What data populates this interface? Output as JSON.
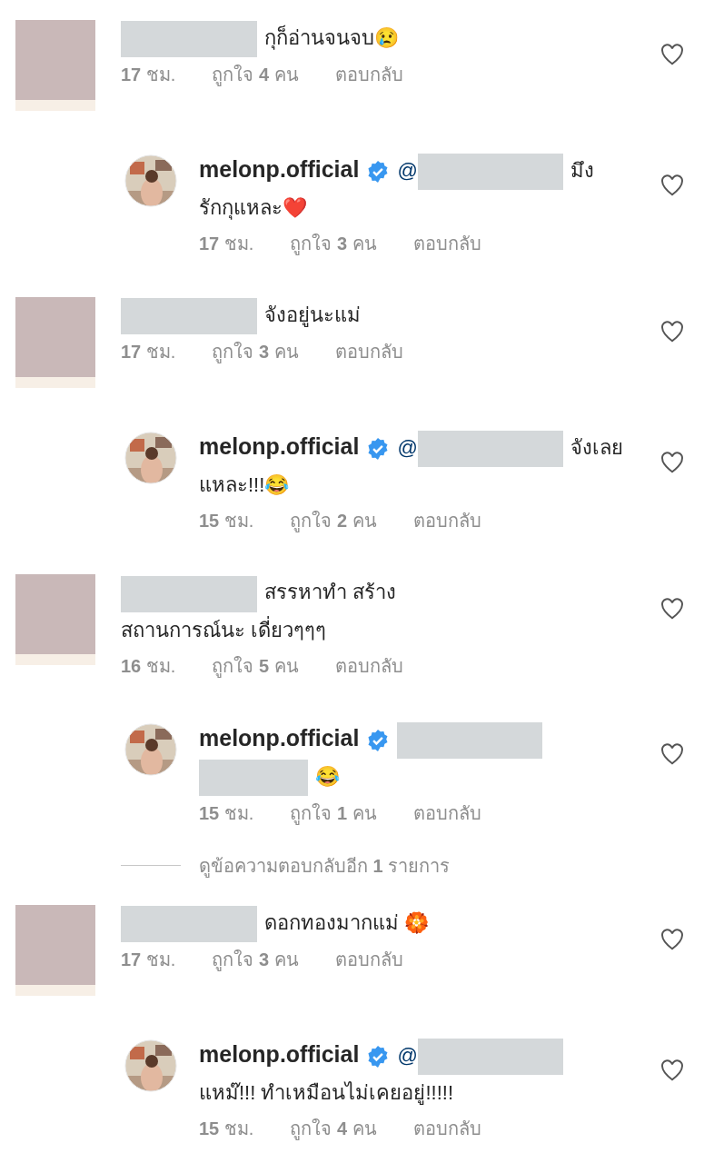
{
  "comments": [
    {
      "kind": "comment",
      "name_redacted": true,
      "head_text": "กุก็อ่านจนจบ😢",
      "time": "**17** ชม.",
      "likes": "ถูกใจ **4** คน",
      "reply_label": "ตอบกลับ",
      "liked": false
    },
    {
      "kind": "reply",
      "username": "melonp.official",
      "verified": true,
      "mention": "@",
      "mention_redacted": true,
      "head_text": "มึง",
      "lines": [
        {
          "text": "รักกุแหละ❤️",
          "redacted": false
        }
      ],
      "time": "**17** ชม.",
      "likes": "ถูกใจ **3** คน",
      "reply_label": "ตอบกลับ",
      "liked": false
    },
    {
      "kind": "comment",
      "name_redacted": true,
      "head_text": "จังอยู่นะแม่",
      "time": "**17** ชม.",
      "likes": "ถูกใจ **3** คน",
      "reply_label": "ตอบกลับ",
      "liked": false
    },
    {
      "kind": "reply",
      "username": "melonp.official",
      "verified": true,
      "mention": "@",
      "mention_redacted": true,
      "head_text": "จังเลย",
      "lines": [
        {
          "text": "แหละ!!!😂",
          "redacted": false
        }
      ],
      "time": "**15** ชม.",
      "likes": "ถูกใจ **2** คน",
      "reply_label": "ตอบกลับ",
      "liked": false
    },
    {
      "kind": "comment",
      "name_redacted": true,
      "head_text": "สรรหาทำ สร้าง",
      "lines": [
        {
          "text": "สถานการณ์นะ เดี่ยวๆๆๆ",
          "redacted": false
        }
      ],
      "time": "**16** ชม.",
      "likes": "ถูกใจ **5** คน",
      "reply_label": "ตอบกลับ",
      "liked": false
    },
    {
      "kind": "reply",
      "username": "melonp.official",
      "verified": true,
      "mention_redacted": true,
      "lines": [
        {
          "text": "😂",
          "redacted": true
        }
      ],
      "time": "**15** ชม.",
      "likes": "ถูกใจ **1** คน",
      "reply_label": "ตอบกลับ",
      "liked": false
    },
    {
      "kind": "more",
      "text": "ดูข้อความตอบกลับอีก **1** รายการ"
    },
    {
      "kind": "comment",
      "name_redacted": true,
      "head_text": "ดอกทองมากแม่ 🏵️",
      "time": "**17** ชม.",
      "likes": "ถูกใจ **3** คน",
      "reply_label": "ตอบกลับ",
      "liked": false
    },
    {
      "kind": "reply",
      "username": "melonp.official",
      "verified": true,
      "mention": "@",
      "mention_redacted": true,
      "lines": [
        {
          "text": "แหม๊!!! ทำเหมือนไม่เคยอยู่!!!!!",
          "redacted": false
        }
      ],
      "time": "**15** ชม.",
      "likes": "ถูกใจ **4** คน",
      "reply_label": "ตอบกลับ",
      "liked": false
    }
  ]
}
